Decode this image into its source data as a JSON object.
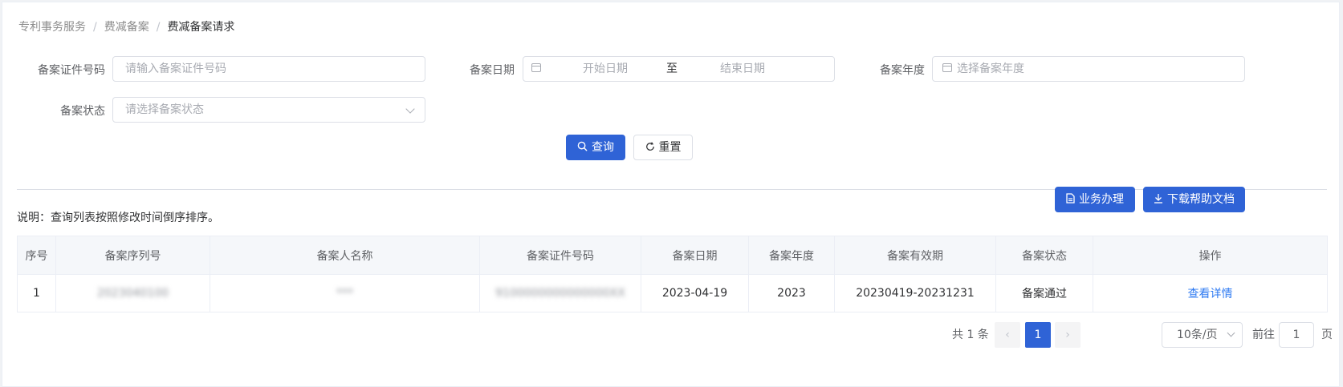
{
  "breadcrumb": [
    "专利事务服务",
    "费减备案",
    "费减备案请求"
  ],
  "breadcrumb_sep": "/",
  "filters": {
    "cert_label": "备案证件号码",
    "cert_placeholder": "请输入备案证件号码",
    "date_label": "备案日期",
    "date_start_placeholder": "开始日期",
    "date_sep": "至",
    "date_end_placeholder": "结束日期",
    "year_label": "备案年度",
    "year_placeholder": "选择备案年度",
    "status_label": "备案状态",
    "status_placeholder": "请选择备案状态"
  },
  "actions": {
    "query": "查询",
    "reset": "重置",
    "business": "业务办理",
    "download": "下载帮助文档"
  },
  "note": "说明：查询列表按照修改时间倒序排序。",
  "table": {
    "headers": [
      "序号",
      "备案序列号",
      "备案人名称",
      "备案证件号码",
      "备案日期",
      "备案年度",
      "备案有效期",
      "备案状态",
      "操作"
    ],
    "rows": [
      {
        "index": "1",
        "serial": "2023040100",
        "name": "***",
        "cert_no": "9100000000000000XX",
        "date": "2023-04-19",
        "year": "2023",
        "validity": "20230419-20231231",
        "status": "备案通过",
        "action": "查看详情"
      }
    ]
  },
  "pagination": {
    "total_label": "共 1 条",
    "prev": "‹",
    "current_page": "1",
    "next": "›",
    "page_size": "10条/页",
    "goto_label": "前往",
    "goto_value": "1",
    "page_suffix": "页"
  },
  "colors": {
    "primary": "#2f63d6",
    "link": "#2f7bf2"
  }
}
